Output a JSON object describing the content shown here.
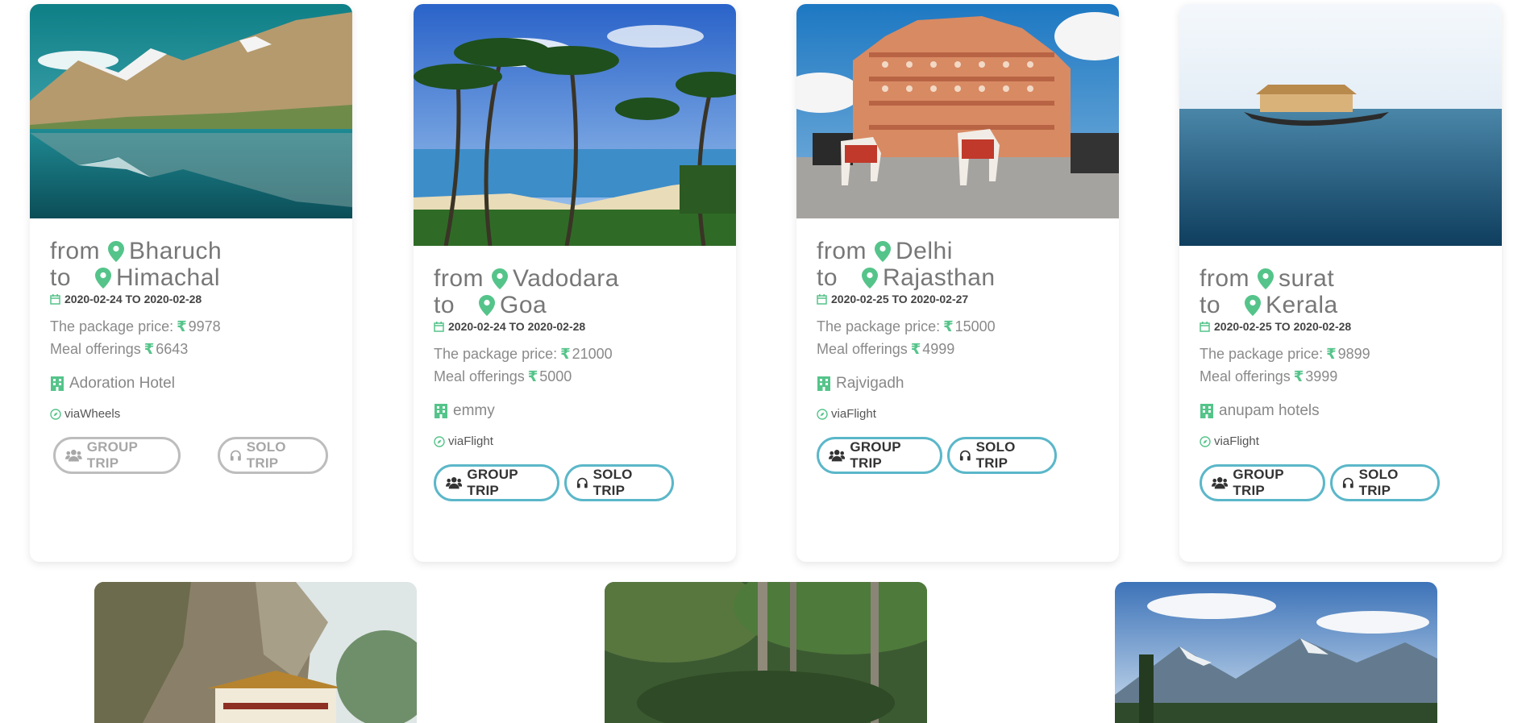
{
  "labels": {
    "from": "from",
    "to": "to",
    "price_label": "The package price:",
    "meal_label": "Meal offerings",
    "rupee": "₹",
    "via_prefix": "via"
  },
  "buttons": {
    "group": "GROUP TRIP",
    "solo": "SOLO TRIP"
  },
  "colors": {
    "accent_green": "#55c48a",
    "button_border": "#5bb7c9",
    "disabled_border": "#bdbdbd"
  },
  "cards": [
    {
      "from": "Bharuch",
      "to": "Himachal",
      "dates": "2020-02-24 TO 2020-02-28",
      "price": "9978",
      "meal": "6643",
      "hotel": "Adoration Hotel",
      "via": "Wheels",
      "buttons_disabled": true
    },
    {
      "from": "Vadodara",
      "to": "Goa",
      "dates": "2020-02-24 TO 2020-02-28",
      "price": "21000",
      "meal": "5000",
      "hotel": "emmy",
      "via": "Flight",
      "buttons_disabled": false
    },
    {
      "from": "Delhi",
      "to": "Rajasthan",
      "dates": "2020-02-25 TO 2020-02-27",
      "price": "15000",
      "meal": "4999",
      "hotel": "Rajvigadh",
      "via": "Flight",
      "buttons_disabled": false
    },
    {
      "from": "surat",
      "to": "Kerala",
      "dates": "2020-02-25 TO 2020-02-28",
      "price": "9899",
      "meal": "3999",
      "hotel": "anupam hotels",
      "via": "Flight",
      "buttons_disabled": false
    }
  ]
}
